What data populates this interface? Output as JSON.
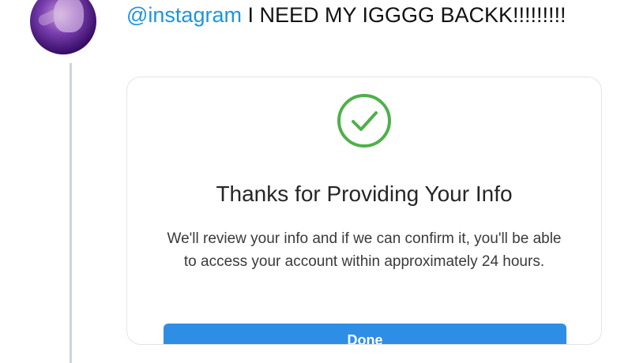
{
  "tweet": {
    "mention": "@instagram",
    "text": " I NEED MY IGGGG BACKK!!!!!!!!!"
  },
  "card": {
    "icon": "check-circle-icon",
    "title": "Thanks for Providing Your Info",
    "body": "We'll review your info and if we can confirm it, you'll be able to access your account within approximately 24 hours.",
    "done_label": "Done"
  },
  "colors": {
    "mention": "#1b95e0",
    "check_green": "#4fb04a",
    "button_blue": "#2e8ee6"
  }
}
